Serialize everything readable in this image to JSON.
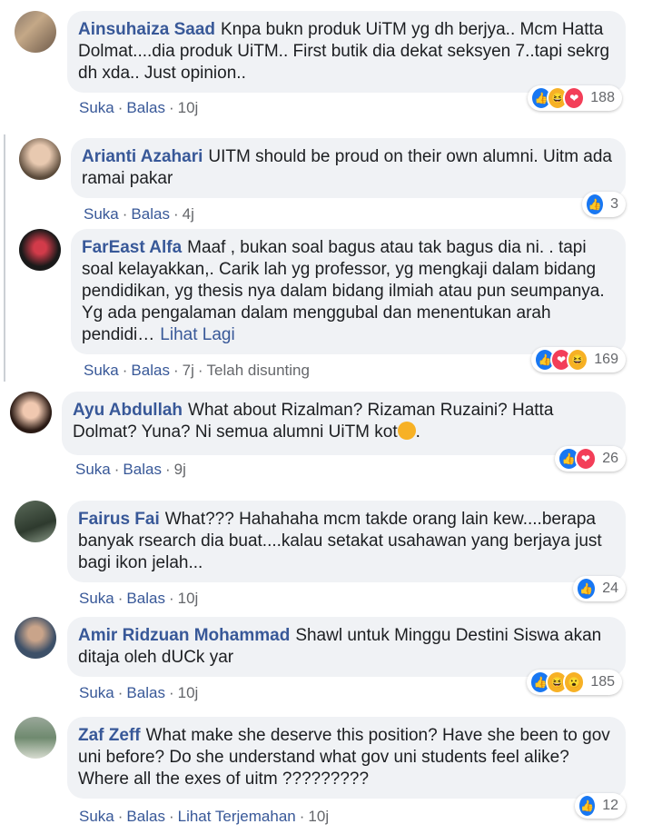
{
  "comments": [
    {
      "author": "Ainsuhaiza Saad",
      "text": "Knpa bukn produk UiTM yg dh berjya.. Mcm Hatta Dolmat....dia produk UiTM.. First butik dia dekat seksyen 7..tapi sekrg dh xda.. Just opinion..",
      "like": "Suka",
      "reply": "Balas",
      "time": "10j",
      "reactions": [
        "like",
        "haha",
        "love"
      ],
      "count": "188"
    },
    {
      "author": "Arianti Azahari",
      "text": "UITM should be proud on their own alumni. Uitm ada ramai pakar",
      "like": "Suka",
      "reply": "Balas",
      "time": "4j",
      "reactions": [
        "like"
      ],
      "count": "3"
    },
    {
      "author": "FarEast Alfa",
      "text": "Maaf , bukan soal bagus atau tak bagus dia ni. . tapi soal kelayakkan,. Carik lah yg professor, yg mengkaji dalam bidang pendidikan, yg thesis nya dalam bidang ilmiah atau pun seumpanya. Yg ada pengalaman dalam menggubal dan menentukan arah pendidi…",
      "more": "Lihat Lagi",
      "like": "Suka",
      "reply": "Balas",
      "time": "7j",
      "edited": "Telah disunting",
      "reactions": [
        "like",
        "love",
        "haha"
      ],
      "count": "169"
    },
    {
      "author": "Ayu Abdullah",
      "text": "What about Rizalman? Rizaman Ruzaini? Hatta Dolmat? Yuna? Ni semua alumni UiTM kot",
      "text_end": ".",
      "like": "Suka",
      "reply": "Balas",
      "time": "9j",
      "reactions": [
        "like",
        "love"
      ],
      "count": "26"
    },
    {
      "author": "Fairus Fai",
      "text": "What??? Hahahaha mcm takde orang lain kew....berapa banyak rsearch dia buat....kalau setakat usahawan yang berjaya just bagi ikon jelah...",
      "like": "Suka",
      "reply": "Balas",
      "time": "10j",
      "reactions": [
        "like"
      ],
      "count": "24"
    },
    {
      "author": "Amir Ridzuan Mohammad",
      "text": "Shawl untuk Minggu Destini Siswa akan ditaja oleh dUCk yar",
      "like": "Suka",
      "reply": "Balas",
      "time": "10j",
      "reactions": [
        "like",
        "haha",
        "wow"
      ],
      "count": "185"
    },
    {
      "author": "Zaf Zeff",
      "text": "What make she deserve this position? Have she been to gov uni before? Do she understand what gov uni students feel alike? Where all the exes of uitm ?????????",
      "like": "Suka",
      "reply": "Balas",
      "time": "10j",
      "translate": "Lihat Terjemahan",
      "reactions": [
        "like"
      ],
      "count": "12"
    }
  ],
  "colors": {
    "author": "#385898",
    "bubble": "#f0f2f5",
    "like": "#1877f2",
    "love": "#f33e58",
    "haha": "#f7b125"
  }
}
